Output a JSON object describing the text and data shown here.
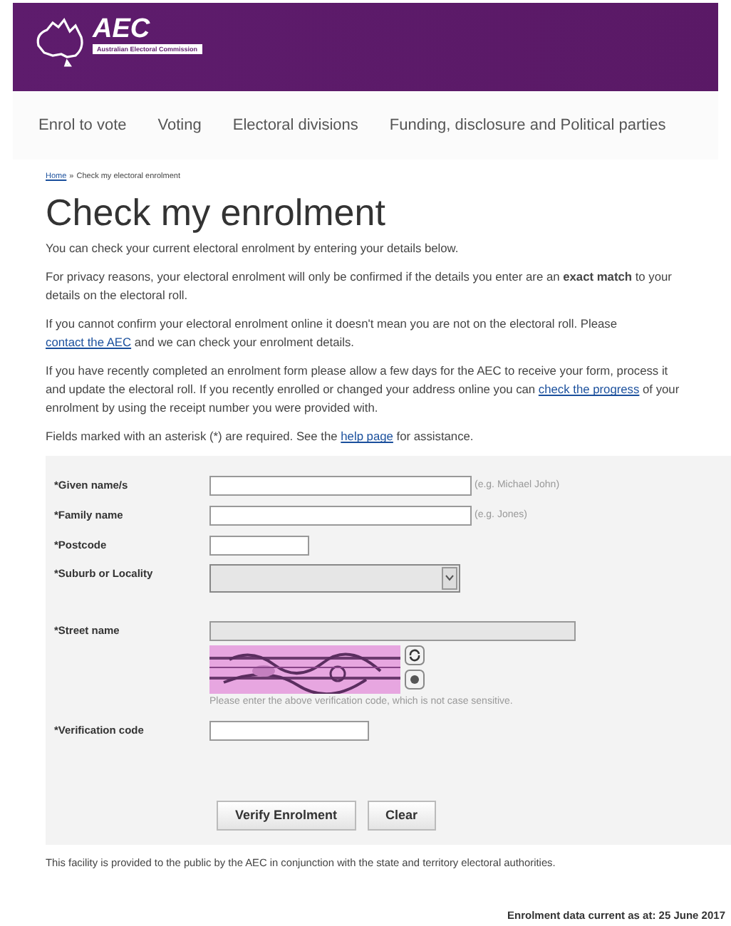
{
  "header": {
    "logo_title": "AEC",
    "logo_subtitle": "Australian Electoral Commission"
  },
  "nav": [
    "Enrol to vote",
    "Voting",
    "Electoral divisions",
    "Funding, disclosure and Political parties"
  ],
  "breadcrumb": {
    "home": "Home",
    "separator": "»",
    "current": "Check my electoral enrolment"
  },
  "title": "Check my enrolment",
  "paragraphs": [
    {
      "parts": [
        {
          "text": "You can check your current electoral enrolment by entering your details below."
        }
      ]
    },
    {
      "parts": [
        {
          "text": "For privacy reasons, your electoral enrolment will only be confirmed if the details you enter are an **exact match** to your details on the electoral roll."
        }
      ]
    },
    {
      "parts": [
        {
          "text": "If you cannot confirm your electoral enrolment online it doesn't mean you are not on the electoral roll. Please "
        },
        {
          "link": "contact the AEC"
        },
        {
          "text": " and we can check your enrolment details."
        }
      ]
    },
    {
      "parts": [
        {
          "text": "If you have recently completed an enrolment form please allow a few days for the AEC to receive your form, process it and update the electoral roll. If you recently enrolled or changed your address online you can "
        },
        {
          "link": "check the progress"
        },
        {
          "text": " of your enrolment by using the receipt number you were provided with."
        }
      ]
    },
    {
      "parts": [
        {
          "text": "Fields marked with an asterisk (*) are required. See the "
        },
        {
          "link": "help page"
        },
        {
          "text": " for assistance."
        }
      ]
    }
  ],
  "form": {
    "fields": [
      {
        "kind": "input",
        "label": "*Given name/s",
        "disabled": false,
        "hint": "(e.g. Michael John)"
      },
      {
        "kind": "input",
        "label": "*Family name",
        "disabled": false,
        "hint": "(e.g. Jones)"
      },
      {
        "kind": "input",
        "label": "*Postcode",
        "disabled": false
      },
      {
        "kind": "select",
        "label": "*Suburb or Locality",
        "disabled": true
      },
      {
        "kind": "input",
        "label": "*Street name",
        "disabled": true
      },
      {
        "kind": "captcha",
        "note": "Please enter the above verification code, which is not case sensitive."
      },
      {
        "kind": "input",
        "label": "*Verification code",
        "disabled": false
      }
    ],
    "buttons": [
      "Verify Enrolment",
      "Clear"
    ]
  },
  "footer_note": "This facility is provided to the public by the AEC in conjunction with the state and territory electoral authorities.",
  "data_date": "Enrolment data current as at: 25 June 2017"
}
